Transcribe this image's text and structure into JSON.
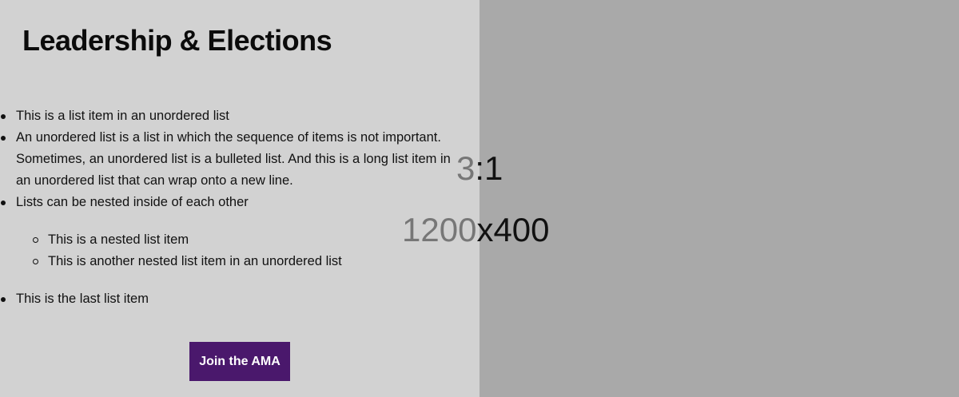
{
  "page": {
    "title": "Leadership & Elections"
  },
  "placeholder_image": {
    "ratio_label_faded": "3",
    "ratio_label_rest": ":1",
    "size_label_faded": "1200",
    "size_label_rest": "x400",
    "left_panel_color": "#d2d2d2",
    "right_panel_color": "#a9a9a9"
  },
  "list": {
    "items": [
      {
        "text": "This is a list item in an unordered list"
      },
      {
        "text": "An unordered list is a list in which the sequence of items is not important. Sometimes, an unordered list is a bulleted list. And this is a long list item in an unordered list that can wrap onto a new line."
      },
      {
        "text": "Lists can be nested inside of each other"
      },
      {
        "text": "This is the last list item"
      }
    ],
    "nested_items": [
      {
        "text": "This is a nested list item"
      },
      {
        "text": "This is another nested list item in an unordered list"
      }
    ]
  },
  "cta": {
    "label": "Join the AMA",
    "color": "#4a186c"
  }
}
